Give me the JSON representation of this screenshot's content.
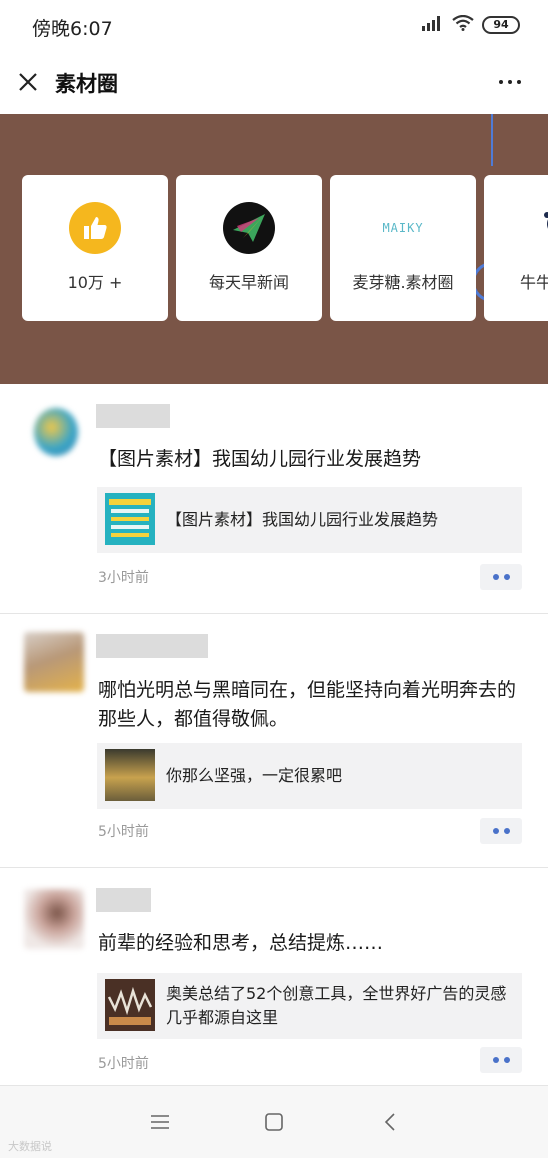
{
  "status": {
    "time": "傍晚6:07",
    "battery": "94"
  },
  "nav": {
    "title": "素材圈"
  },
  "cards": [
    {
      "label": "10万 +",
      "icon": "thumbs-up-icon"
    },
    {
      "label": "每天早新闻",
      "icon": "paper-plane-logo"
    },
    {
      "label": "麦芽糖.素材圈",
      "logo_text": "MAIKY",
      "icon": "maiky-logo"
    },
    {
      "label": "牛牛",
      "icon": "cartoon-logo"
    }
  ],
  "posts": [
    {
      "text": "【图片素材】我国幼儿园行业发展趋势",
      "share_title": "【图片素材】我国幼儿园行业发展趋势",
      "time": "3小时前"
    },
    {
      "text": "哪怕光明总与黑暗同在，但能坚持向着光明奔去的那些人，都值得敬佩。",
      "share_title": "你那么坚强，一定很累吧",
      "time": "5小时前"
    },
    {
      "text": "前辈的经验和思考，总结提炼……",
      "share_title": "奥美总结了52个创意工具，全世界好广告的灵感几乎都源自这里",
      "time": "5小时前"
    }
  ],
  "watermark": "大数据说",
  "colors": {
    "banner": "#7a5547",
    "accent": "#4a72c9",
    "thumb_yellow": "#f5b71e"
  }
}
